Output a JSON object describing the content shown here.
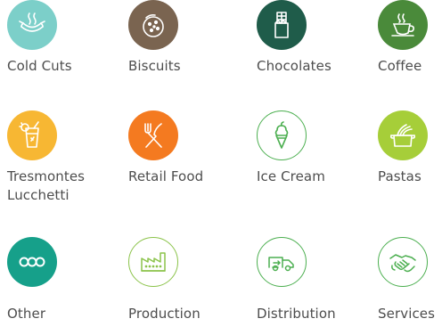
{
  "categories": [
    {
      "label": "Cold Cuts",
      "icon": "sausage-icon",
      "color": "#7ccfc9"
    },
    {
      "label": "Biscuits",
      "icon": "cookie-icon",
      "color": "#7a6450"
    },
    {
      "label": "Chocolates",
      "icon": "chocolate-bar-icon",
      "color": "#1f5c4a"
    },
    {
      "label": "Coffee",
      "icon": "coffee-cup-icon",
      "color": "#4a8a3a"
    },
    {
      "label": "Tresmontes",
      "label_line2": "Lucchetti",
      "icon": "cocktail-glass-icon",
      "color": "#f7b733"
    },
    {
      "label": "Retail Food",
      "icon": "fork-knife-icon",
      "color": "#f47a20"
    },
    {
      "label": "Ice Cream",
      "icon": "ice-cream-cone-icon",
      "color": "#ffffff",
      "outline": "#4caf50"
    },
    {
      "label": "Pastas",
      "icon": "pasta-pot-icon",
      "color": "#a6ce39"
    },
    {
      "label": "Other",
      "icon": "three-circles-icon",
      "color": "#16a08a"
    },
    {
      "label": "Production",
      "icon": "factory-icon",
      "color": "#ffffff",
      "outline": "#8bc34a"
    },
    {
      "label": "Distribution",
      "icon": "delivery-truck-icon",
      "color": "#ffffff",
      "outline": "#4caf50"
    },
    {
      "label": "Services",
      "icon": "handshake-icon",
      "color": "#ffffff",
      "outline": "#4caf50"
    }
  ]
}
